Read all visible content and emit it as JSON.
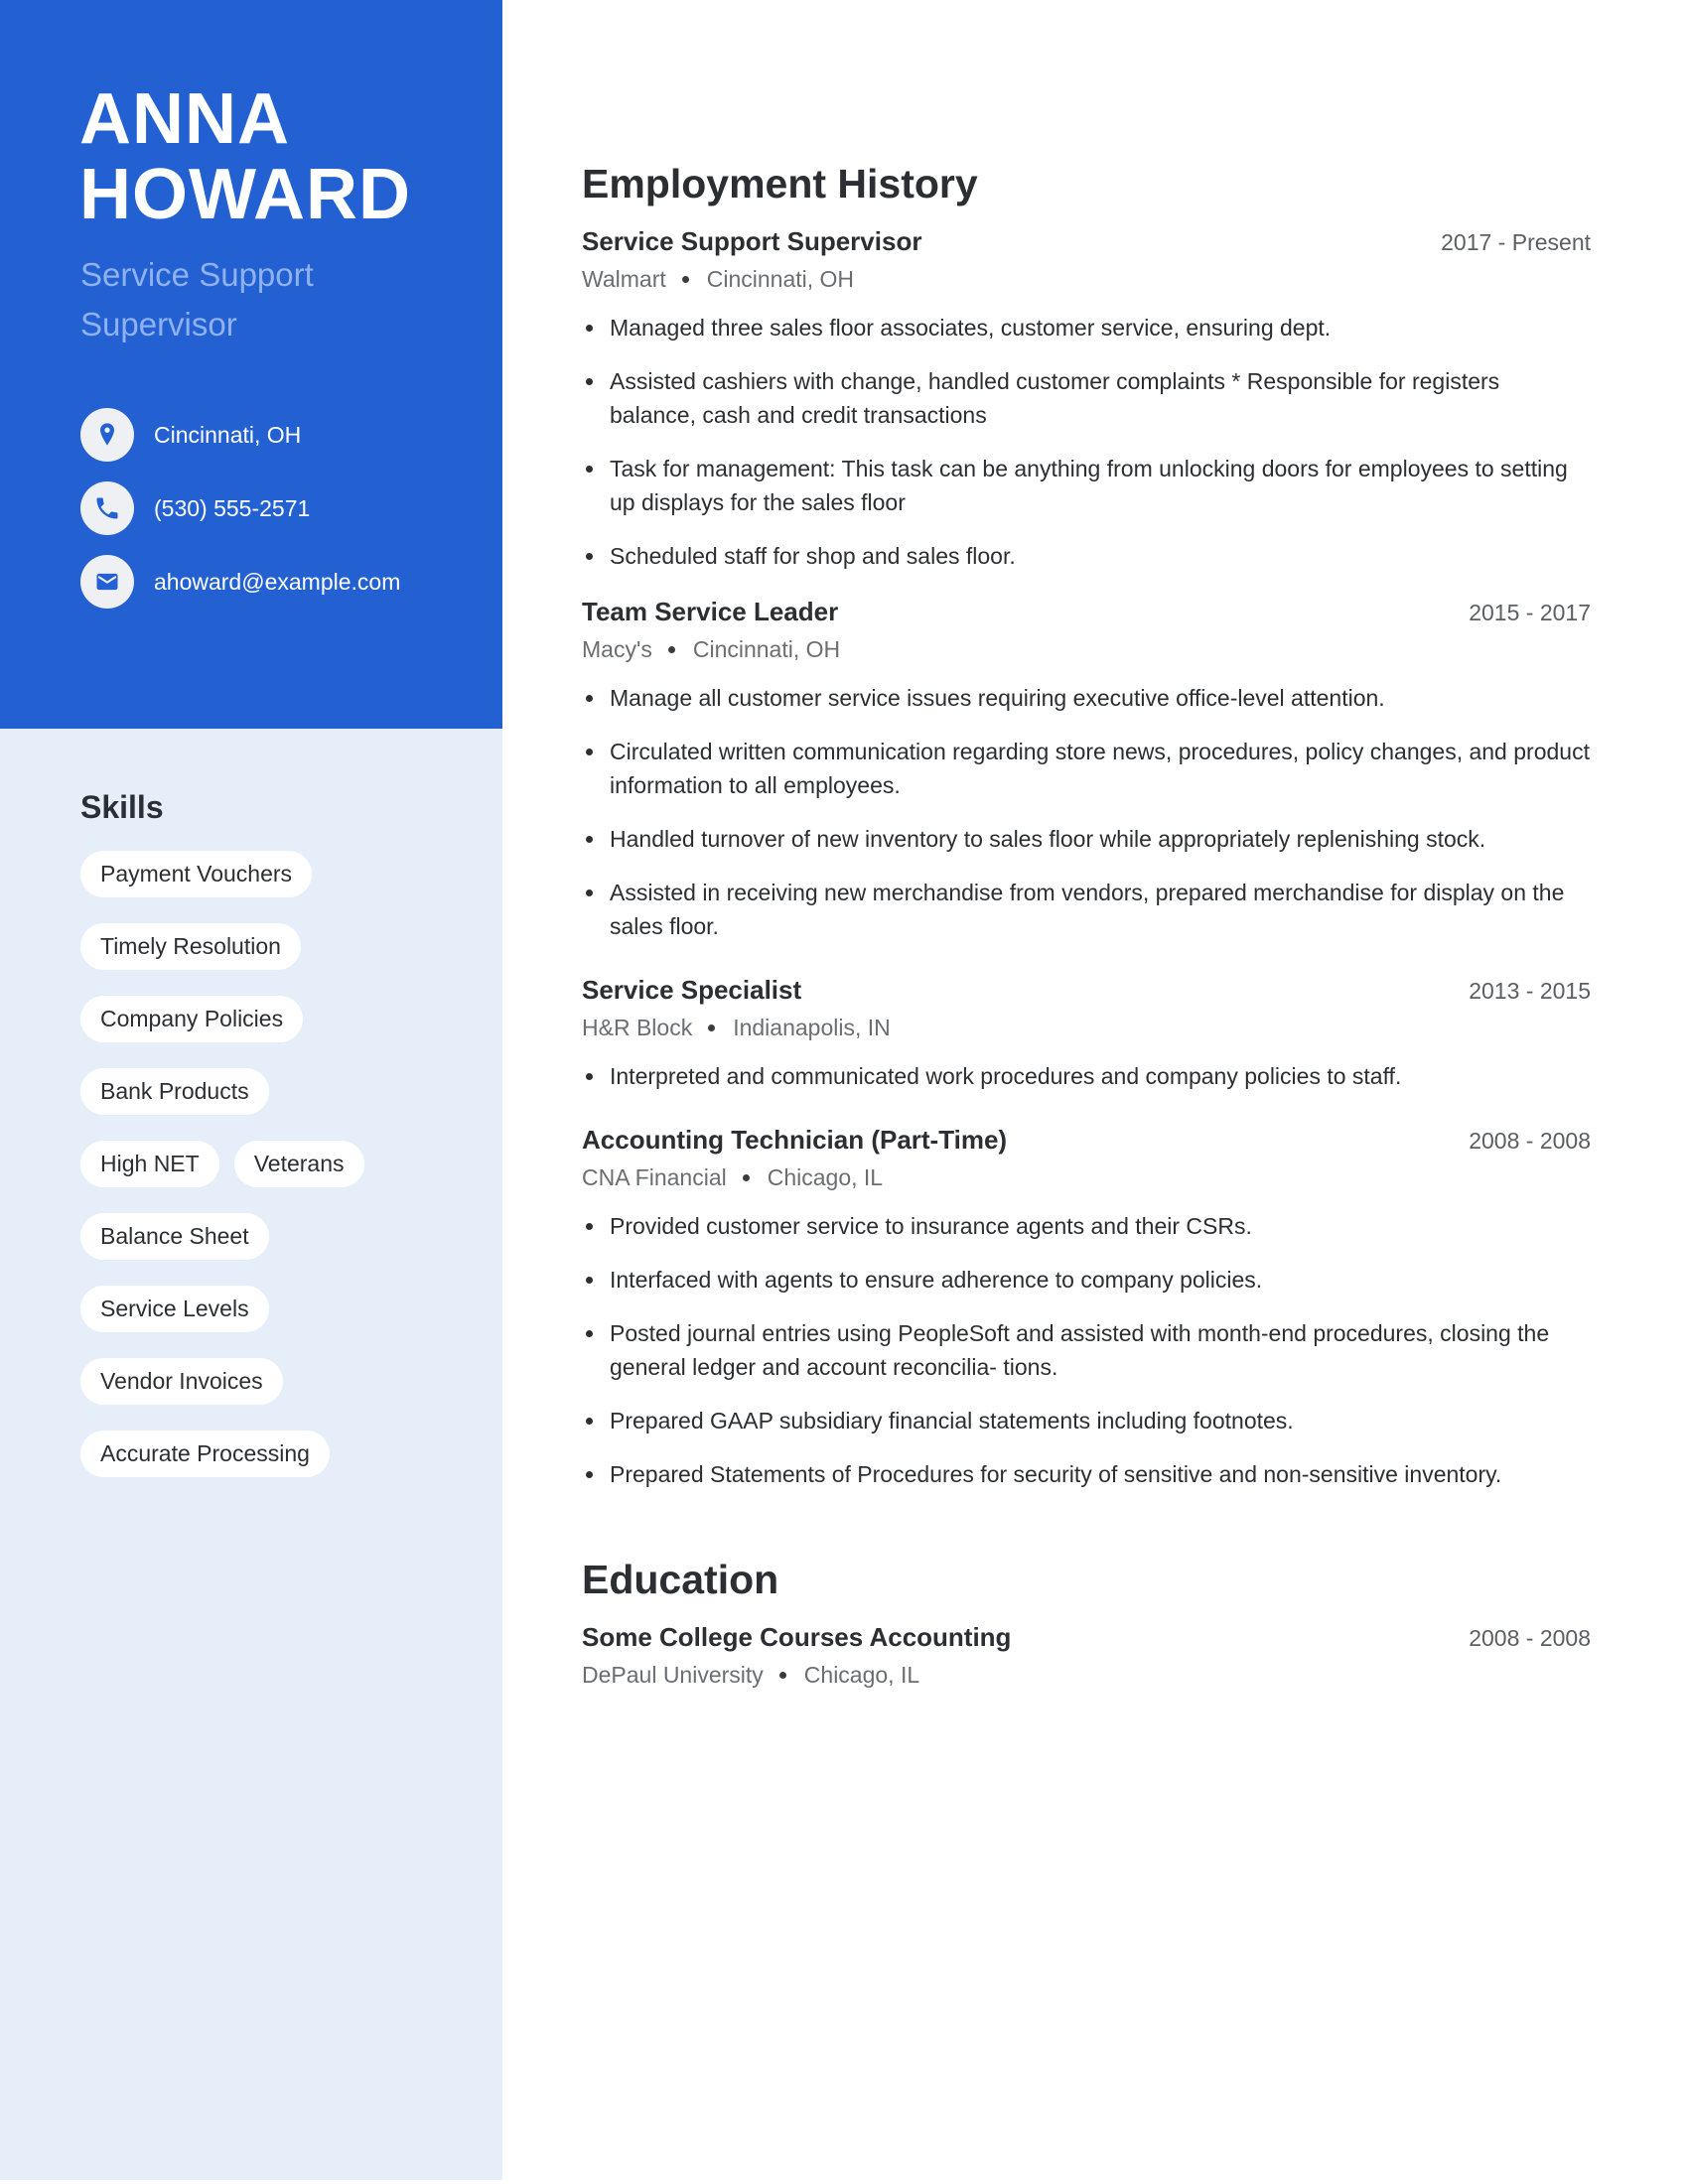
{
  "profile": {
    "first_name": "ANNA",
    "last_name": "HOWARD",
    "headline": "Service Support Supervisor",
    "accent_color": "#2361d3",
    "sidebar_color": "#e6eefa"
  },
  "contacts": [
    {
      "icon": "location-pin-icon",
      "text": "Cincinnati, OH"
    },
    {
      "icon": "phone-icon",
      "text": "(530) 555-2571"
    },
    {
      "icon": "mail-icon",
      "text": "ahoward@example.com"
    }
  ],
  "skills": {
    "title": "Skills",
    "items": [
      "Payment Vouchers",
      "Timely Resolution",
      "Company Policies",
      "Bank Products",
      "High NET",
      "Veterans",
      "Balance Sheet",
      "Service Levels",
      "Vendor Invoices",
      "Accurate Processing"
    ]
  },
  "employment": {
    "title": "Employment History",
    "jobs": [
      {
        "title": "Service Support Supervisor",
        "dates": "2017 - Present",
        "company": "Walmart",
        "location": "Cincinnati, OH",
        "bullets": [
          "Managed three sales floor associates, customer service, ensuring dept.",
          "Assisted cashiers with change, handled customer complaints * Responsible for registers balance, cash and credit transactions",
          "Task for management: This task can be anything from unlocking doors for employees to setting up displays for the sales floor",
          "Scheduled staff for shop and sales floor."
        ]
      },
      {
        "title": "Team Service Leader",
        "dates": "2015 - 2017",
        "company": "Macy's",
        "location": "Cincinnati, OH",
        "bullets": [
          "Manage all customer service issues requiring executive office-level attention.",
          "Circulated written communication regarding store news, procedures, policy changes, and product information to all employees.",
          "Handled turnover of new inventory to sales floor while appropriately replenishing stock.",
          "Assisted in receiving new merchandise from vendors, prepared merchandise for display on the sales floor."
        ]
      },
      {
        "title": "Service Specialist",
        "dates": "2013 - 2015",
        "company": "H&R Block",
        "location": "Indianapolis, IN",
        "bullets": [
          "Interpreted and communicated work procedures and company policies to staff."
        ]
      },
      {
        "title": "Accounting Technician (Part-Time)",
        "dates": "2008 - 2008",
        "company": "CNA Financial",
        "location": "Chicago, IL",
        "bullets": [
          "Provided customer service to insurance agents and their CSRs.",
          "Interfaced with agents to ensure adherence to company policies.",
          "Posted journal entries using PeopleSoft and assisted with month-end procedures, closing the general ledger and account reconcilia- tions.",
          "Prepared GAAP subsidiary financial statements including footnotes.",
          "Prepared Statements of Procedures for security of sensitive and non-sensitive inventory."
        ]
      }
    ]
  },
  "education": {
    "title": "Education",
    "entries": [
      {
        "title": "Some College Courses Accounting",
        "dates": "2008 - 2008",
        "school": "DePaul University",
        "location": "Chicago, IL"
      }
    ]
  }
}
